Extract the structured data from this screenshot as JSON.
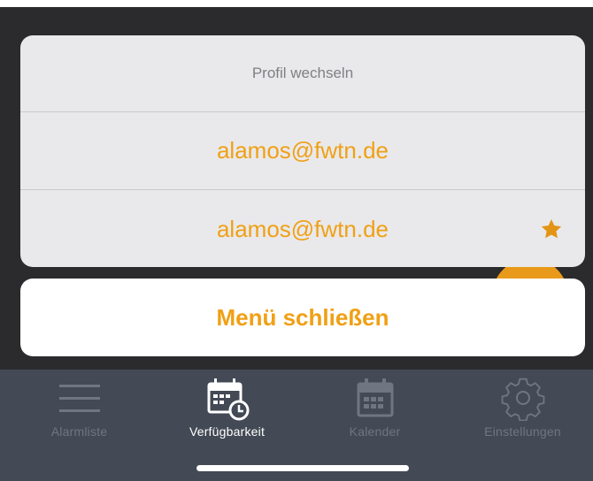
{
  "action_sheet": {
    "title": "Profil wechseln",
    "items": [
      {
        "label": "alamos@fwtn.de",
        "favorite": false
      },
      {
        "label": "alamos@fwtn.de",
        "favorite": true
      }
    ],
    "close_label": "Menü schließen"
  },
  "tabbar": {
    "tabs": [
      {
        "label": "Alarmliste",
        "icon": "list-icon",
        "active": false
      },
      {
        "label": "Verfügbarkeit",
        "icon": "calendar-clock-icon",
        "active": true
      },
      {
        "label": "Kalender",
        "icon": "calendar-icon",
        "active": false
      },
      {
        "label": "Einstellungen",
        "icon": "gear-icon",
        "active": false
      }
    ]
  },
  "colors": {
    "accent": "#f0a015",
    "sheet_bg": "#e9e9eb",
    "tabbar_bg": "#434a55",
    "inactive_tab": "#6f7681"
  }
}
